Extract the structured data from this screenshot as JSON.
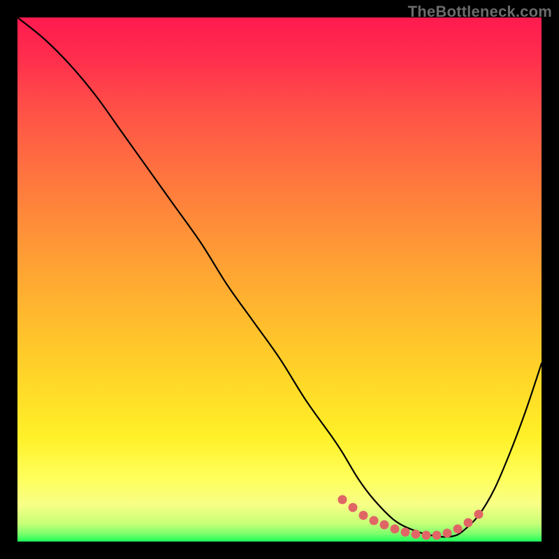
{
  "watermark": "TheBottleneck.com",
  "colors": {
    "background": "#000000",
    "gradient_stops": [
      {
        "offset": 0.0,
        "color": "#ff1a4f"
      },
      {
        "offset": 0.08,
        "color": "#ff2f4d"
      },
      {
        "offset": 0.18,
        "color": "#ff5247"
      },
      {
        "offset": 0.3,
        "color": "#ff743f"
      },
      {
        "offset": 0.42,
        "color": "#ff9437"
      },
      {
        "offset": 0.55,
        "color": "#ffb52f"
      },
      {
        "offset": 0.68,
        "color": "#ffd428"
      },
      {
        "offset": 0.8,
        "color": "#fff028"
      },
      {
        "offset": 0.88,
        "color": "#ffff5c"
      },
      {
        "offset": 0.93,
        "color": "#f7ff86"
      },
      {
        "offset": 0.965,
        "color": "#c9ff78"
      },
      {
        "offset": 0.985,
        "color": "#7dff6c"
      },
      {
        "offset": 1.0,
        "color": "#1cff5a"
      }
    ],
    "curve": "#000000",
    "marker": "#e06666"
  },
  "chart_data": {
    "type": "line",
    "title": "",
    "xlabel": "",
    "ylabel": "",
    "xlim": [
      0,
      100
    ],
    "ylim": [
      0,
      100
    ],
    "series": [
      {
        "name": "bottleneck-curve",
        "x": [
          0,
          5,
          10,
          15,
          20,
          25,
          30,
          35,
          40,
          45,
          50,
          55,
          60,
          62,
          65,
          68,
          72,
          76,
          80,
          83,
          85,
          88,
          91,
          94,
          97,
          100
        ],
        "y": [
          100,
          96,
          91,
          85,
          78,
          71,
          64,
          57,
          49,
          42,
          35,
          27,
          20,
          17,
          12,
          8,
          4,
          2,
          1,
          1,
          2,
          5,
          10,
          17,
          25,
          34
        ]
      }
    ],
    "markers": {
      "name": "optimal-range",
      "x": [
        62,
        64,
        66,
        68,
        70,
        72,
        74,
        76,
        78,
        80,
        82,
        84,
        86,
        88
      ],
      "y": [
        8,
        6.5,
        5,
        4,
        3.2,
        2.4,
        1.8,
        1.4,
        1.2,
        1.2,
        1.6,
        2.4,
        3.6,
        5.2
      ]
    }
  }
}
